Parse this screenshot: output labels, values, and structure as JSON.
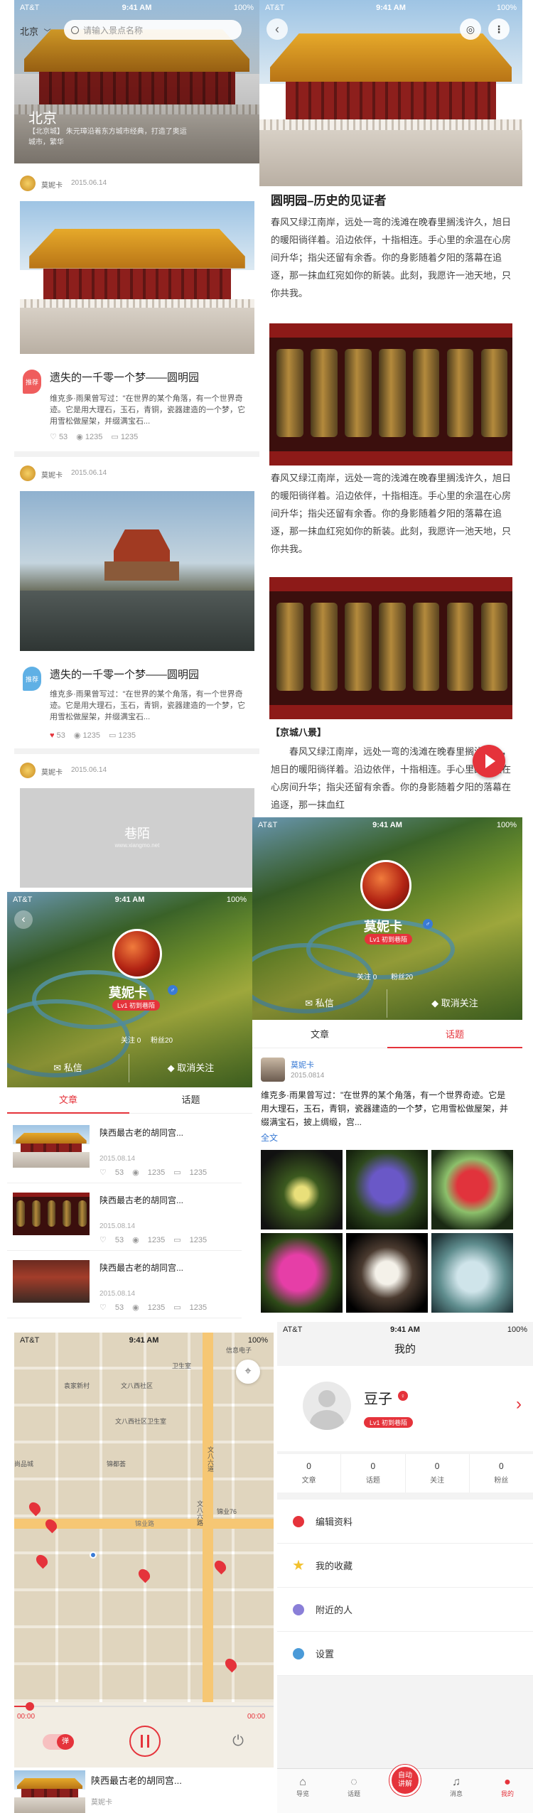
{
  "status": {
    "carrier": "AT&T",
    "time": "9:41 AM",
    "battery": "100%"
  },
  "home": {
    "city_selector": "北京",
    "search_placeholder": "请输入景点名称",
    "banner_title": "北京",
    "banner_text": "【北京城】 朱元璋沿着东方城市经典，打造了奥运城市，繁华"
  },
  "feed": [
    {
      "author": "莫妮卡",
      "date": "2015.06.14",
      "badge": "推荐",
      "title": "遗失的一千零一个梦——圆明园",
      "excerpt": "维克多·雨果曾写过：\"在世界的某个角落，有一个世界奇迹。它是用大理石，玉石，青铜，瓷器建造的一个梦，它用雪松做屋架，并缀满宝石...",
      "likes": "53",
      "views": "1235",
      "comments": "1235",
      "liked": false
    },
    {
      "author": "莫妮卡",
      "date": "2015.06.14",
      "badge": "推荐",
      "title": "遗失的一千零一个梦——圆明园",
      "excerpt": "维克多·雨果曾写过：\"在世界的某个角落，有一个世界奇迹。它是用大理石，玉石，青铜，瓷器建造的一个梦，它用雪松做屋架，并缀满宝石...",
      "likes": "53",
      "views": "1235",
      "comments": "1235",
      "liked": true
    },
    {
      "author": "莫妮卡",
      "date": "2015.06.14"
    }
  ],
  "placeholder_logo": "巷陌",
  "placeholder_url": "www.xiangmo.net",
  "article": {
    "title": "圆明园–历史的见证者",
    "para": "春风又绿江南岸，远处一弯的浅滩在晚春里搁浅许久，旭日的暖阳徜徉着。沿边依伴，十指相连。手心里的余温在心房间升华；指尖还留有余香。你的身影随着夕阳的落幕在追逐，那一抹血红宛如你的新装。此刻，我愿许一池天地，只你共我。",
    "section": "【京城八景】",
    "para2": "春风又绿江南岸，远处一弯的浅滩在晚春里搁浅许久，旭日的暖阳徜徉着。沿边依伴，十指相连。手心里的余温在心房间升华；指尖还留有余香。你的身影随着夕阳的落幕在追逐，那一抹血红"
  },
  "profile": {
    "name": "莫妮卡",
    "level": "Lv1 初到巷陌",
    "follow_label": "关注",
    "follow_count": "0",
    "fans_label": "粉丝",
    "fans_count": "20",
    "message_btn": "私信",
    "unfollow_btn": "取消关注",
    "tab_articles": "文章",
    "tab_topics": "话题"
  },
  "list": [
    {
      "title": "陕西最古老的胡同宫...",
      "date": "2015.08.14",
      "likes": "53",
      "views": "1235",
      "comments": "1235"
    },
    {
      "title": "陕西最古老的胡同宫...",
      "date": "2015.08.14",
      "likes": "53",
      "views": "1235",
      "comments": "1235"
    },
    {
      "title": "陕西最古老的胡同宫...",
      "date": "2015.08.14",
      "likes": "53",
      "views": "1235",
      "comments": "1235"
    }
  ],
  "topic": {
    "author": "莫妮卡",
    "date": "2015.0814",
    "text": "维克多·雨果曾写过：\"在世界的某个角落，有一个世界奇迹。它是用大理石，玉石，青铜，瓷器建造的一个梦，它用雪松做屋架，并缀满宝石，披上绸缎，宫...",
    "full_link": "全文"
  },
  "map": {
    "labels": [
      "卫生室",
      "文八西社区",
      "文八西社区卫生室",
      "袁家新村",
      "锦都荟",
      "文八六道",
      "尚品城",
      "锦业76",
      "文八六路",
      "锦业路",
      "信息电子"
    ],
    "time_start": "00:00",
    "time_end": "00:00",
    "danmu": "弹",
    "player_title": "陕西最古老的胡同宫...",
    "player_author": "莫妮卡"
  },
  "me": {
    "title": "我的",
    "name": "豆子",
    "level": "Lv1 初到巷陌",
    "stats": [
      {
        "value": "0",
        "label": "文章"
      },
      {
        "value": "0",
        "label": "话题"
      },
      {
        "value": "0",
        "label": "关注"
      },
      {
        "value": "0",
        "label": "粉丝"
      }
    ],
    "menu": [
      "编辑资料",
      "我的收藏",
      "附近的人",
      "设置"
    ],
    "tabs": [
      "导览",
      "话题",
      "自动讲解",
      "消息",
      "我的"
    ]
  },
  "colors": {
    "accent": "#e5333b",
    "blue": "#3a7bd5"
  }
}
